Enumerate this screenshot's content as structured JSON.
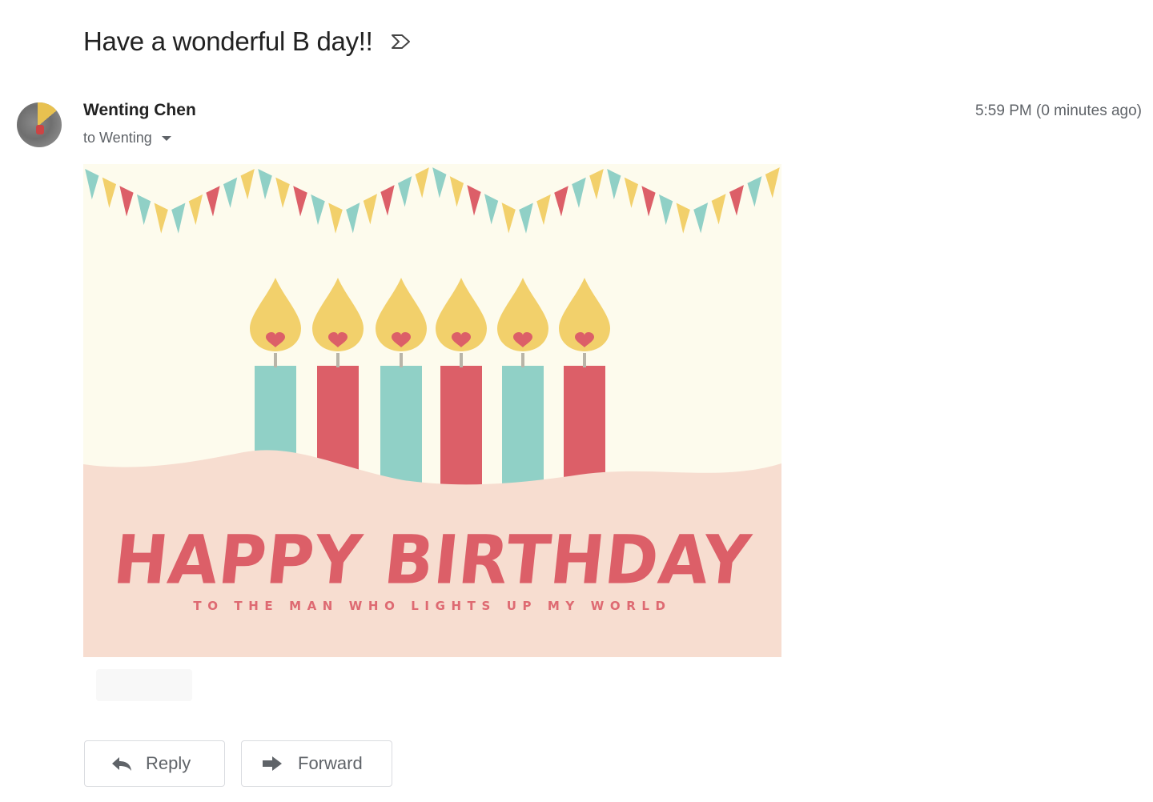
{
  "email": {
    "subject": "Have a wonderful B day!!",
    "label_icon": "label-arrow-icon",
    "sender": {
      "name": "Wenting Chen",
      "recipient_line": "to Wenting",
      "avatar_icon": "avatar-photo"
    },
    "timestamp": "5:59 PM (0 minutes ago)"
  },
  "card": {
    "title": "HAPPY BIRTHDAY",
    "subtitle": "TO THE MAN WHO LIGHTS UP MY WORLD",
    "colors": {
      "background": "#fdfbed",
      "ground": "#f7ddd0",
      "teal": "#90d0c6",
      "red": "#dc5f68",
      "yellow": "#f2d06b"
    },
    "candle_colors": [
      "teal",
      "red",
      "teal",
      "red",
      "teal",
      "red"
    ]
  },
  "actions": {
    "reply_label": "Reply",
    "forward_label": "Forward",
    "reply_icon": "reply-arrow-icon",
    "forward_icon": "forward-arrow-icon"
  }
}
